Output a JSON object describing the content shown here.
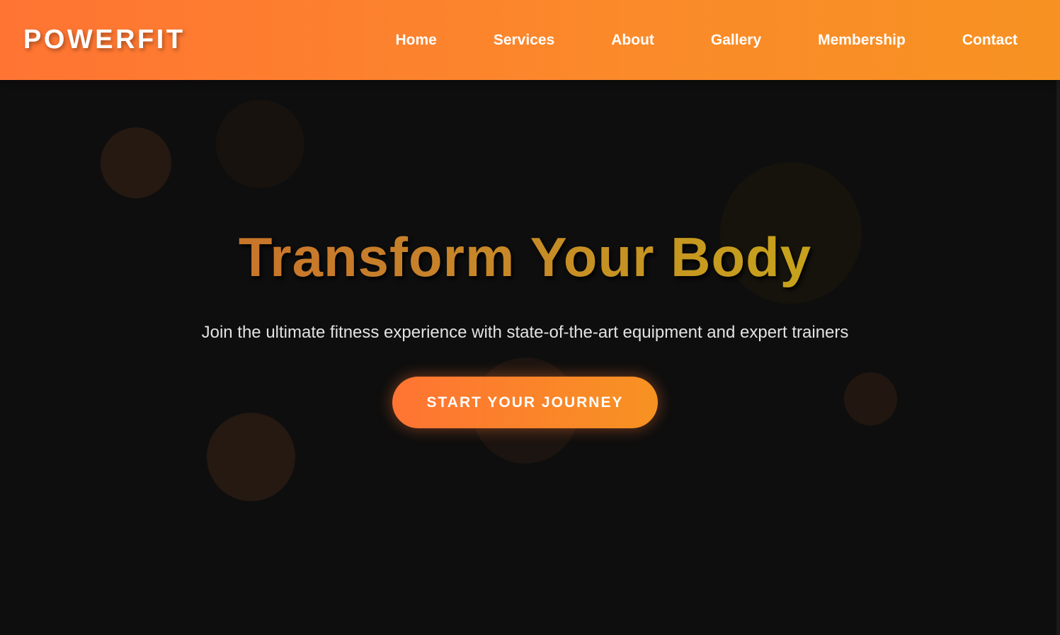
{
  "header": {
    "logo": "POWERFIT",
    "nav": [
      {
        "label": "Home"
      },
      {
        "label": "Services"
      },
      {
        "label": "About"
      },
      {
        "label": "Gallery"
      },
      {
        "label": "Membership"
      },
      {
        "label": "Contact"
      }
    ]
  },
  "hero": {
    "title": "Transform Your Body",
    "subtitle": "Join the ultimate fitness experience with state-of-the-art equipment and expert trainers",
    "cta_label": "START YOUR JOURNEY"
  },
  "colors": {
    "brand_orange": "#ff7433",
    "brand_amber": "#f79222",
    "background": "#0e0e0e",
    "title_gold": "#c6a11c"
  }
}
